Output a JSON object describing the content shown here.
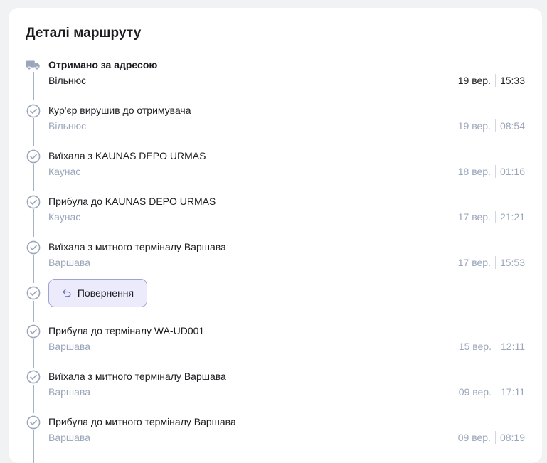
{
  "title": "Деталі маршруту",
  "events": [
    {
      "icon": "truck-icon",
      "status": "Отримано за адресою",
      "city": "Вільнюс",
      "date": "19 вер.",
      "time": "15:33"
    },
    {
      "icon": "check-circle-icon",
      "status": "Кур'єр вирушив до отримувача",
      "city": "Вільнюс",
      "date": "19 вер.",
      "time": "08:54"
    },
    {
      "icon": "check-circle-icon",
      "status": "Виїхала з KAUNAS DEPO URMAS",
      "city": "Каунас",
      "date": "18 вер.",
      "time": "01:16"
    },
    {
      "icon": "check-circle-icon",
      "status": "Прибула до KAUNAS DEPO URMAS",
      "city": "Каунас",
      "date": "17 вер.",
      "time": "21:21"
    },
    {
      "icon": "check-circle-icon",
      "status": "Виїхала з митного терміналу Варшава",
      "city": "Варшава",
      "date": "17 вер.",
      "time": "15:53"
    },
    {
      "icon": "check-circle-icon",
      "status": "Прибула до терміналу WA-UD001",
      "city": "Варшава",
      "date": "15 вер.",
      "time": "12:11"
    },
    {
      "icon": "check-circle-icon",
      "status": "Виїхала з митного терміналу Варшава",
      "city": "Варшава",
      "date": "09 вер.",
      "time": "17:11"
    },
    {
      "icon": "check-circle-icon",
      "status": "Прибула до митного терміналу Варшава",
      "city": "Варшава",
      "date": "09 вер.",
      "time": "08:19"
    }
  ],
  "return_button": {
    "label": "Повернення",
    "icon": "undo-arrow-icon"
  },
  "colors": {
    "muted": "#9aa6ba",
    "line": "#a9b2c3",
    "button_bg": "#ebebfb",
    "button_border": "#9ea3d4"
  }
}
